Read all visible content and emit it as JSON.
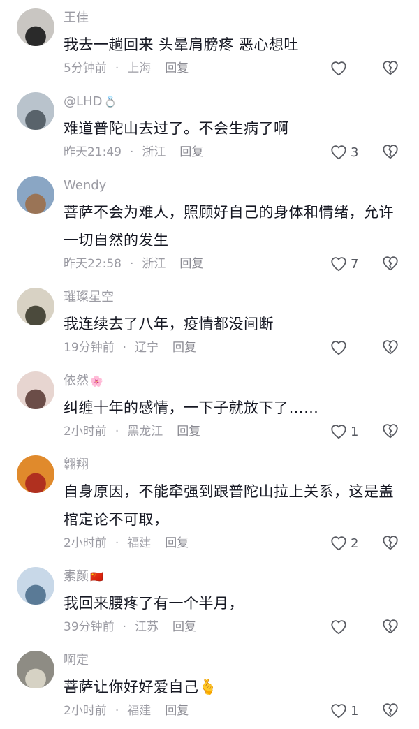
{
  "comments": [
    {
      "name": "王佳",
      "name_deco": "",
      "text": "我去一趟回来  头晕肩膀疼 恶心想吐",
      "time": "5分钟前",
      "region": "上海",
      "reply": "回复",
      "likes": "",
      "avatar_colors": [
        "#c9c6c2",
        "#2a2a2a"
      ]
    },
    {
      "name": "@LHD",
      "name_deco": "💍",
      "text": "难道普陀山去过了。不会生病了啊",
      "time": "昨天21:49",
      "region": "浙江",
      "reply": "回复",
      "likes": "3",
      "avatar_colors": [
        "#b9c3cc",
        "#59636b"
      ]
    },
    {
      "name": "Wendy",
      "name_deco": "",
      "text": "菩萨不会为难人，照顾好自己的身体和情绪，允许一切自然的发生",
      "time": "昨天22:58",
      "region": "浙江",
      "reply": "回复",
      "likes": "7",
      "avatar_colors": [
        "#8aa6c4",
        "#9a7456"
      ]
    },
    {
      "name": "璀璨星空",
      "name_deco": "",
      "text": "我连续去了八年，疫情都没间断",
      "time": "19分钟前",
      "region": "辽宁",
      "reply": "回复",
      "likes": "",
      "avatar_colors": [
        "#d8d2c4",
        "#4b4a3c"
      ]
    },
    {
      "name": "依然",
      "name_deco": "🌸",
      "text": "纠缠十年的感情，一下子就放下了……",
      "time": "2小时前",
      "region": "黑龙江",
      "reply": "回复",
      "likes": "1",
      "avatar_colors": [
        "#e7d5d0",
        "#6b4d48"
      ]
    },
    {
      "name": "翱翔",
      "name_deco": "",
      "text": "自身原因，不能牵强到跟普陀山拉上关系，这是盖棺定论不可取，",
      "time": "2小时前",
      "region": "福建",
      "reply": "回复",
      "likes": "2",
      "avatar_colors": [
        "#e08a2c",
        "#b0301f"
      ]
    },
    {
      "name": "素颜",
      "name_deco": "🇨🇳",
      "text": "我回来腰疼了有一个半月，",
      "time": "39分钟前",
      "region": "江苏",
      "reply": "回复",
      "likes": "",
      "avatar_colors": [
        "#c8d8e8",
        "#5a7a96"
      ]
    },
    {
      "name": "啊定",
      "name_deco": "",
      "text": "菩萨让你好好爱自己🫰",
      "time": "2小时前",
      "region": "福建",
      "reply": "回复",
      "likes": "1",
      "avatar_colors": [
        "#8e8c84",
        "#d6d2c4"
      ]
    }
  ]
}
